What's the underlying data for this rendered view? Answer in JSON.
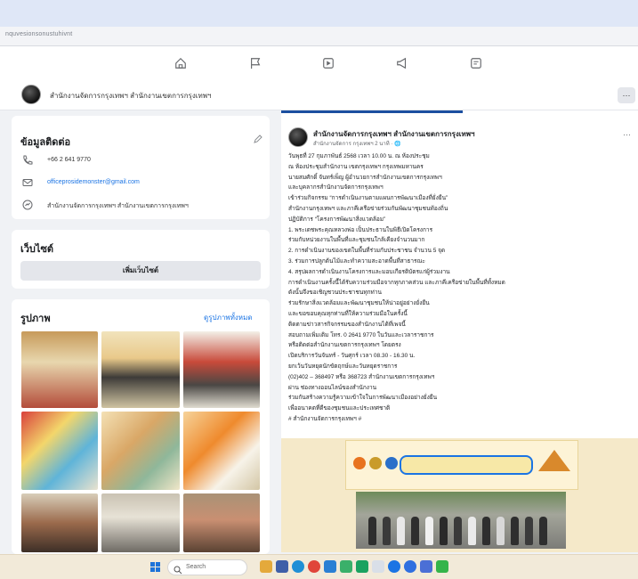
{
  "browser": {
    "url_text": "nquvesionsonustuhivnt"
  },
  "nav": {
    "icons": [
      "home-icon",
      "flag-icon",
      "video-icon",
      "megaphone-icon",
      "notifications-icon"
    ]
  },
  "page": {
    "name": "สำนักงานจัดการกรุงเทพฯ สำนักงานเขตการกรุงเทพฯ",
    "more_label": "···"
  },
  "contact": {
    "title": "ข้อมูลติดต่อ",
    "phone": "+66 2 641 9770",
    "email": "officeprosidemonster@gmail.com",
    "messenger": "สำนักงานจัดการกรุงเทพฯ สำนักงานเขตการกรุงเทพฯ"
  },
  "website": {
    "title": "เว็บไซต์",
    "add_label": "เพิ่มเว็บไซต์"
  },
  "photos": {
    "title": "รูปภาพ",
    "see_all": "ดูรูปภาพทั้งหมด"
  },
  "post": {
    "author": "สำนักงานจัดการกรุงเทพฯ สำนักงานเขตการกรุงเทพฯ",
    "meta": "สำนักงานจัดการ กรุงเทพฯ 2 นาที · 🌐",
    "dots": "···",
    "lines": [
      "วันพุธที่ 27 กุมภาพันธ์ 2568 เวลา 10.00 น. ณ ห้องประชุม",
      "ณ ห้องประชุมสำนักงาน เขตกรุงเทพฯ กรุงเทพมหานคร",
      "นายสมศักดิ์ จันทร์เพ็ญ ผู้อำนวยการสำนักงานเขตการกรุงเทพฯ",
      "และบุคลากรสำนักงานจัดการกรุงเทพฯ",
      "เข้าร่วมกิจกรรม “การดำเนินงานตามแผนการพัฒนาเมืองที่ยั่งยืน”",
      "สำนักงานกรุงเทพฯ และภาคีเครือข่ายร่วมกันพัฒนาชุมชนท้องถิ่น",
      "ปฏิบัติการ “โครงการพัฒนาสิ่งแวดล้อม”",
      "      1. พระเดชพระคุณหลวงพ่อ เป็นประธานในพิธีเปิดโครงการ",
      "ร่วมกับหน่วยงานในพื้นที่และชุมชนใกล้เคียงจำนวนมาก",
      "      2. การดำเนินงานของเขตในพื้นที่ร่วมกับประชาชน จำนวน 5 จุด",
      "      3. ร่วมการปลูกต้นไม้และทำความสะอาดพื้นที่สาธารณะ",
      "      4. สรุปผลการดำเนินงานโครงการและมอบเกียรติบัตรแก่ผู้ร่วมงาน",
      "การดำเนินงานครั้งนี้ได้รับความร่วมมือจากทุกภาคส่วน และภาคีเครือข่ายในพื้นที่ทั้งหมด",
      "ดังนั้นจึงขอเชิญชวนประชาชนทุกท่าน",
      "ร่วมรักษาสิ่งแวดล้อมและพัฒนาชุมชนให้น่าอยู่อย่างยั่งยืน",
      "และขอขอบคุณทุกท่านที่ให้ความร่วมมือในครั้งนี้",
      "ติดตามข่าวสารกิจกรรมของสำนักงานได้ที่เพจนี้",
      "สอบถามเพิ่มเติม โทร. 0 2641 9770 ในวันและเวลาราชการ",
      "หรือติดต่อสำนักงานเขตการกรุงเทพฯ โดยตรง",
      "เปิดบริการวันจันทร์ - วันศุกร์ เวลา 08.30 - 16.30 น.",
      "ยกเว้นวันหยุดนักขัตฤกษ์และวันหยุดราชการ",
      "(02)402 – 368497 หรือ 368723 สำนักงานเขตการกรุงเทพฯ",
      "ผ่าน ช่องทางออนไลน์ของสำนักงาน",
      "ร่วมกันสร้างความรู้ความเข้าใจในการพัฒนาเมืองอย่างยั่งยืน",
      "เพื่ออนาคตที่ดีของชุมชนและประเทศชาติ",
      "# สำนักงานจัดการกรุงเทพฯ #"
    ]
  },
  "taskbar": {
    "search_placeholder": "Search"
  }
}
